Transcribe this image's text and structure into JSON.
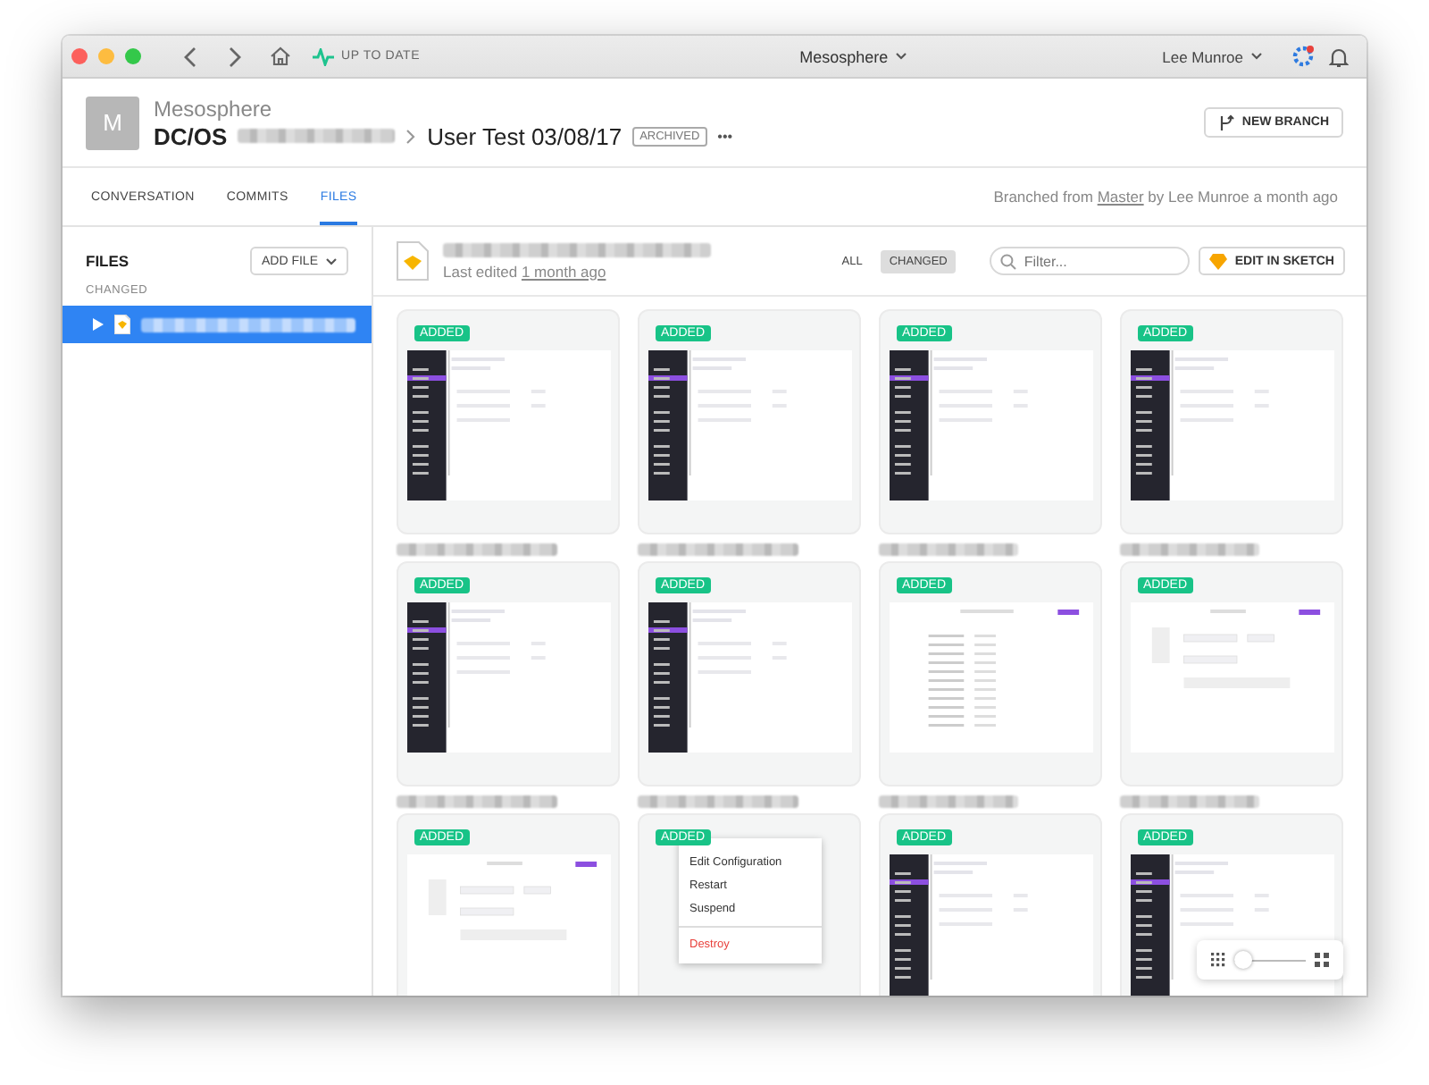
{
  "window": {
    "title": "Mesosphere",
    "status": "UP TO DATE",
    "user": "Lee Munroe"
  },
  "project": {
    "avatar": "M",
    "org": "Mesosphere",
    "name": "DC/OS",
    "branch": "User Test 03/08/17",
    "badge": "ARCHIVED",
    "more": "•••",
    "new_branch": "NEW BRANCH"
  },
  "tabs": [
    {
      "label": "CONVERSATION",
      "selected": false
    },
    {
      "label": "COMMITS",
      "selected": false
    },
    {
      "label": "FILES",
      "selected": true
    }
  ],
  "branch_info": {
    "prefix": "Branched from",
    "link": "Master",
    "suffix": "by Lee Munroe a month ago"
  },
  "sidebar": {
    "title": "FILES",
    "add_file": "ADD FILE",
    "section": "CHANGED",
    "items": [
      {
        "selected": true
      }
    ]
  },
  "file_header": {
    "edited_label": "Last edited",
    "edited_link": "1 month ago",
    "edit_button": "EDIT IN SKETCH",
    "search": {
      "placeholder": "Filter..."
    },
    "filters": [
      {
        "label": "ALL",
        "selected": false
      },
      {
        "label": "CHANGED",
        "selected": true
      }
    ]
  },
  "cards": [
    {
      "badge": "ADDED",
      "kind": "sidebar"
    },
    {
      "badge": "ADDED",
      "kind": "sidebar"
    },
    {
      "badge": "ADDED",
      "kind": "sidebar"
    },
    {
      "badge": "ADDED",
      "kind": "sidebar"
    },
    {
      "badge": "ADDED",
      "kind": "sidebar"
    },
    {
      "badge": "ADDED",
      "kind": "sidebar"
    },
    {
      "badge": "ADDED",
      "kind": "detail"
    },
    {
      "badge": "ADDED",
      "kind": "form"
    },
    {
      "badge": "ADDED",
      "kind": "form"
    },
    {
      "badge": "ADDED",
      "kind": "menu",
      "menu": [
        {
          "label": "Edit Configuration",
          "kind": "normal"
        },
        {
          "label": "Restart",
          "kind": "normal"
        },
        {
          "label": "Suspend",
          "kind": "normal"
        },
        {
          "label": "Destroy",
          "kind": "danger"
        }
      ]
    },
    {
      "badge": "ADDED",
      "kind": "sidebar"
    },
    {
      "badge": "ADDED",
      "kind": "sidebar"
    }
  ],
  "zoom": {
    "level": 0.12
  }
}
